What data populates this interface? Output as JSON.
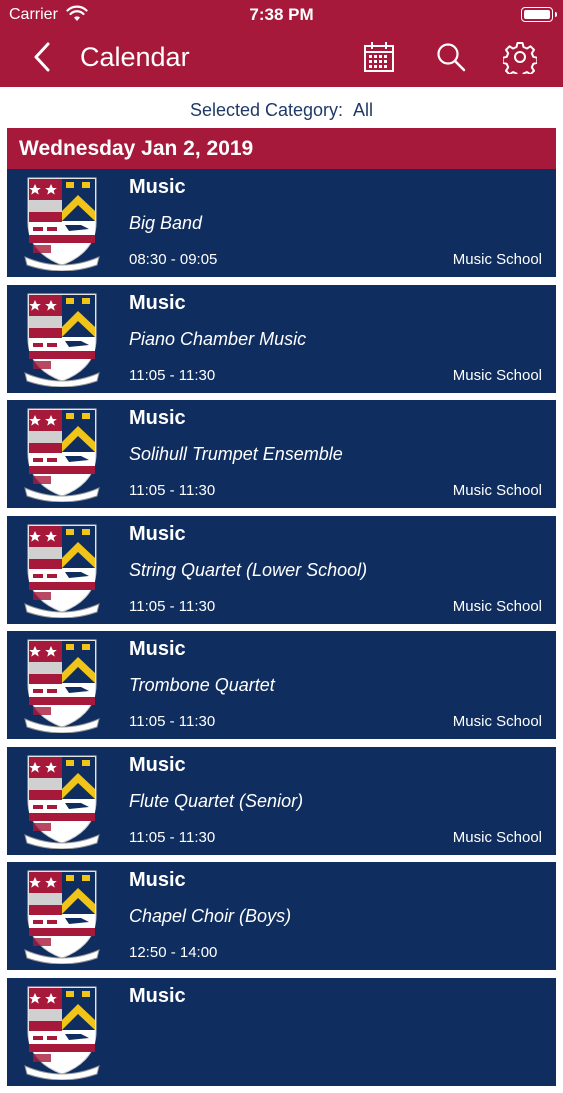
{
  "status_bar": {
    "carrier": "Carrier",
    "time": "7:38 PM"
  },
  "header": {
    "title": "Calendar",
    "icons": [
      "back-chevron-icon",
      "calendar-icon",
      "search-icon",
      "gear-icon"
    ]
  },
  "filter": {
    "label": "Selected Category:",
    "value": "All"
  },
  "date_heading": "Wednesday Jan 2, 2019",
  "colors": {
    "header": "#a6193a",
    "event_bg": "#0f2d5e",
    "filter_text": "#1f3a66"
  },
  "events": [
    {
      "category": "Music",
      "name": "Big Band",
      "time": "08:30 - 09:05",
      "location": "Music School"
    },
    {
      "category": "Music",
      "name": "Piano Chamber Music",
      "time": "11:05 - 11:30",
      "location": "Music School"
    },
    {
      "category": "Music",
      "name": "Solihull Trumpet Ensemble",
      "time": "11:05 - 11:30",
      "location": "Music School"
    },
    {
      "category": "Music",
      "name": "String Quartet (Lower School)",
      "time": "11:05 - 11:30",
      "location": "Music School"
    },
    {
      "category": "Music",
      "name": "Trombone Quartet",
      "time": "11:05 - 11:30",
      "location": "Music School"
    },
    {
      "category": "Music",
      "name": "Flute Quartet (Senior)",
      "time": "11:05 - 11:30",
      "location": "Music School"
    },
    {
      "category": "Music",
      "name": "Chapel Choir (Boys)",
      "time": "12:50 - 14:00",
      "location": ""
    },
    {
      "category": "Music",
      "name": "",
      "time": "",
      "location": ""
    }
  ]
}
